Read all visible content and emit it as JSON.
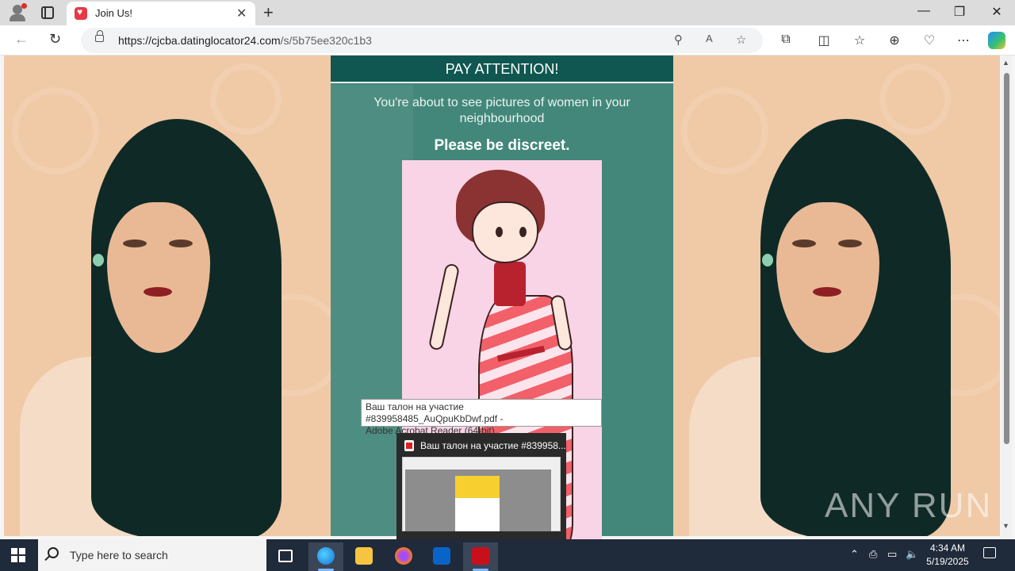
{
  "browser": {
    "tab_title": "Join Us!",
    "url_host": "https://cjcba.datinglocator24.com",
    "url_path": "/s/5b75ee320c1b3"
  },
  "page": {
    "header": "PAY ATTENTION!",
    "notice": "You're about to see pictures of women in your neighbourhood",
    "discreet": "Please be discreet."
  },
  "tooltip": {
    "line1": "Ваш талон на участие #839958485_AuQpuKbDwf.pdf -",
    "line2": "Adobe Acrobat Reader (64-bit)"
  },
  "preview": {
    "title": "Ваш талон на участие #839958..."
  },
  "watermark": "ANY RUN",
  "taskbar": {
    "search_placeholder": "Type here to search",
    "time": "4:34 AM",
    "date": "5/19/2025"
  },
  "colors": {
    "header_bg": "#0f5750",
    "panel_bg": "#43877b",
    "taskbar_bg": "#1f2a3a"
  }
}
